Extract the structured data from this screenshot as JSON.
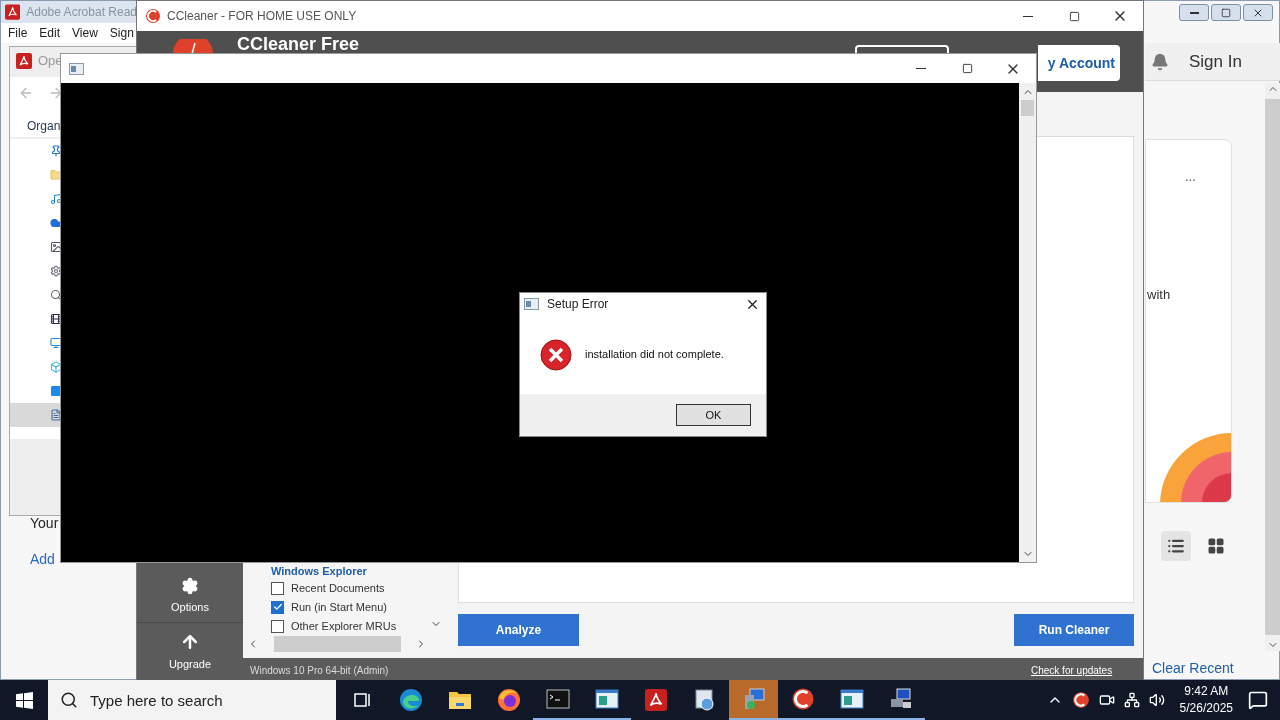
{
  "acrobat": {
    "title": "Adobe Acrobat Read",
    "menu": [
      "File",
      "Edit",
      "View",
      "Sign"
    ],
    "tab": "Ope",
    "toolbar": "Organ",
    "nav_items": [
      {
        "kind": "pin",
        "selected": false
      },
      {
        "kind": "folder",
        "selected": false
      },
      {
        "kind": "music",
        "selected": false
      },
      {
        "kind": "cloud",
        "selected": false
      },
      {
        "kind": "picture",
        "selected": false
      },
      {
        "kind": "gear",
        "selected": false
      },
      {
        "kind": "search",
        "selected": false
      },
      {
        "kind": "film",
        "selected": false
      },
      {
        "kind": "monitor",
        "selected": false
      },
      {
        "kind": "cube",
        "selected": false
      },
      {
        "kind": "desktop",
        "selected": false
      },
      {
        "kind": "document",
        "selected": true
      }
    ],
    "home_texts": [
      "Your",
      "Add"
    ],
    "sign_in": "Sign In",
    "more": "...",
    "card_text": "with",
    "view_modes": [
      {
        "kind": "list",
        "selected": true
      },
      {
        "kind": "grid",
        "selected": false
      }
    ],
    "clear_recent": "Clear Recent"
  },
  "ccleaner": {
    "title": "CCleaner - FOR HOME USE ONLY",
    "heading": "CCleaner Free",
    "account": "y Account",
    "sidebar": [
      {
        "kind": "options",
        "label": "Options"
      },
      {
        "kind": "upgrade",
        "label": "Upgrade"
      }
    ],
    "tree": {
      "heading": "Windows Explorer",
      "items": [
        {
          "label": "Recent Documents",
          "checked": false
        },
        {
          "label": "Run (in Start Menu)",
          "checked": true
        },
        {
          "label": "Other Explorer MRUs",
          "checked": false
        }
      ]
    },
    "analyze": "Analyze",
    "run": "Run Cleaner",
    "status": "Windows 10 Pro 64-bit (Admin)",
    "update_link": "Check for updates"
  },
  "dialog": {
    "title": "Setup Error",
    "message": "installation did not complete.",
    "button": "OK"
  },
  "taskbar": {
    "search_placeholder": "Type here to search",
    "apps": [
      {
        "kind": "taskview",
        "running": false,
        "active": false
      },
      {
        "kind": "edge",
        "running": false,
        "active": false
      },
      {
        "kind": "explorer",
        "running": false,
        "active": false
      },
      {
        "kind": "firefox",
        "running": false,
        "active": false
      },
      {
        "kind": "terminal",
        "running": true,
        "active": false
      },
      {
        "kind": "window",
        "running": true,
        "active": false
      },
      {
        "kind": "acrobat",
        "running": false,
        "active": false
      },
      {
        "kind": "control",
        "running": false,
        "active": false
      },
      {
        "kind": "installer",
        "running": true,
        "active": true
      },
      {
        "kind": "ccleaner",
        "running": true,
        "active": false
      },
      {
        "kind": "window",
        "running": true,
        "active": false
      },
      {
        "kind": "network",
        "running": true,
        "active": false
      }
    ],
    "time": "9:42 AM",
    "date": "5/26/2025"
  }
}
